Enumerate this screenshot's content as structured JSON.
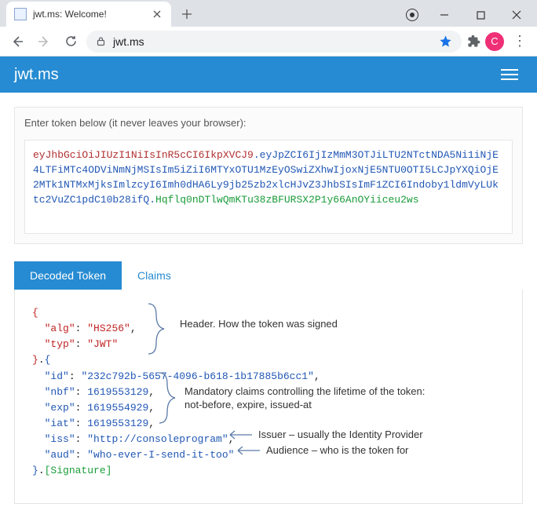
{
  "browser": {
    "tab_title": "jwt.ms: Welcome!",
    "url": "jwt.ms",
    "avatar_letter": "C"
  },
  "appbar": {
    "brand": "jwt.ms"
  },
  "input": {
    "label": "Enter token below (it never leaves your browser):",
    "token_header": "eyJhbGciOiJIUzI1NiIsInR5cCI6IkpXVCJ9",
    "token_payload": "eyJpZCI6IjIzMmM3OTJiLTU2NTctNDA5Ni1iNjE4LTFiMTc4ODViNmNjMSIsIm5iZiI6MTYxOTU1MzEyOSwiZXhwIjoxNjE5NTU0OTI5LCJpYXQiOjE2MTk1NTMxMjksImlzcyI6Imh0dHA6Ly9jb25zb2xlcHJvZ3JhbSIsImF1ZCI6Indoby1ldmVyLUktc2VuZC1pdC10b28ifQ",
    "token_signature": "Hqflq0nDTlwQmKTu38zBFURSX2P1y66AnOYiiceu2ws"
  },
  "tabs": {
    "decoded": "Decoded Token",
    "claims": "Claims"
  },
  "decoded": {
    "alg_key": "\"alg\"",
    "alg_val": "\"HS256\"",
    "typ_key": "\"typ\"",
    "typ_val": "\"JWT\"",
    "id_key": "\"id\"",
    "id_val": "\"232c792b-5657-4096-b618-1b17885b6cc1\"",
    "nbf_key": "\"nbf\"",
    "nbf_val": "1619553129",
    "exp_key": "\"exp\"",
    "exp_val": "1619554929",
    "iat_key": "\"iat\"",
    "iat_val": "1619553129",
    "iss_key": "\"iss\"",
    "iss_val": "\"http://consoleprogram\"",
    "aud_key": "\"aud\"",
    "aud_val": "\"who-ever-I-send-it-too\"",
    "sig_label": "[Signature]"
  },
  "annotations": {
    "header": "Header. How the token was signed",
    "lifetime": "Mandatory claims controlling the lifetime of the token:\nnot-before, expire, issued-at",
    "issuer": "Issuer – usually the Identity Provider",
    "audience": "Audience – who is the token for"
  }
}
